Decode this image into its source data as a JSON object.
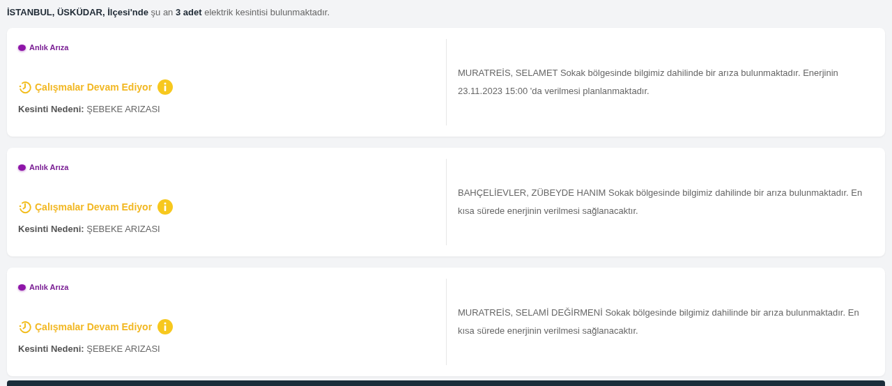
{
  "summary": "**İSTANBUL, ÜSKÜDAR, İlçesi'nde** şu an **3 adet** elektrik kesintisi bulunmaktadır.",
  "outages": [
    {
      "type": "Anlık Arıza",
      "status": "Çalışmalar Devam Ediyor",
      "reason": "**Kesinti Nedeni:** ŞEBEKE ARIZASI",
      "description": "MURATREİS, SELAMET Sokak bölgesinde bilgimiz dahilinde bir arıza bulunmaktadır. Enerjinin 23.11.2023 15:00 'da verilmesi planlanmaktadır."
    },
    {
      "type": "Anlık Arıza",
      "status": "Çalışmalar Devam Ediyor",
      "reason": "**Kesinti Nedeni:** ŞEBEKE ARIZASI",
      "description": "BAHÇELİEVLER, ZÜBEYDE HANIM Sokak bölgesinde bilgimiz dahilinde bir arıza bulunmaktadır. En kısa sürede enerjinin verilmesi sağlanacaktır."
    },
    {
      "type": "Anlık Arıza",
      "status": "Çalışmalar Devam Ediyor",
      "reason": "**Kesinti Nedeni:** ŞEBEKE ARIZASI",
      "description": "MURATREİS, SELAMİ DEĞİRMENİ Sokak bölgesinde bilgimiz dahilinde bir arıza bulunmaktadır. En kısa sürede enerjinin verilmesi sağlanacaktır."
    }
  ]
}
